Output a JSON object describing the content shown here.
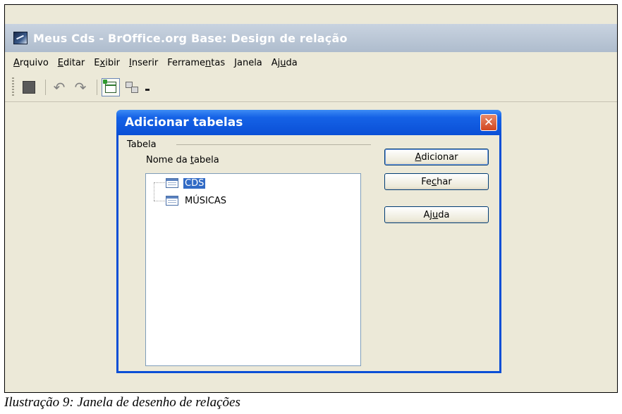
{
  "window": {
    "title": "Meus Cds - BrOffice.org Base: Design de relação"
  },
  "menubar": {
    "items": [
      {
        "pre": "",
        "key": "A",
        "post": "rquivo"
      },
      {
        "pre": "",
        "key": "E",
        "post": "ditar"
      },
      {
        "pre": "E",
        "key": "x",
        "post": "ibir"
      },
      {
        "pre": "",
        "key": "I",
        "post": "nserir"
      },
      {
        "pre": "Ferrame",
        "key": "n",
        "post": "tas"
      },
      {
        "pre": "",
        "key": "J",
        "post": "anela"
      },
      {
        "pre": "Aj",
        "key": "u",
        "post": "da"
      }
    ]
  },
  "dialog": {
    "title": "Adicionar tabelas",
    "close_glyph": "✕",
    "group_label": "Tabela",
    "column_label": {
      "pre": "Nome da ",
      "key": "t",
      "post": "abela"
    },
    "tables": [
      "CDS",
      "MÚSICAS"
    ],
    "selected_table": "CDS",
    "buttons": {
      "add": {
        "pre": "",
        "key": "A",
        "post": "dicionar"
      },
      "close": {
        "pre": "Fe",
        "key": "c",
        "post": "har"
      },
      "help": {
        "pre": "Aj",
        "key": "u",
        "post": "da"
      }
    }
  },
  "caption": "Ilustração 9: Janela de desenho de relações"
}
